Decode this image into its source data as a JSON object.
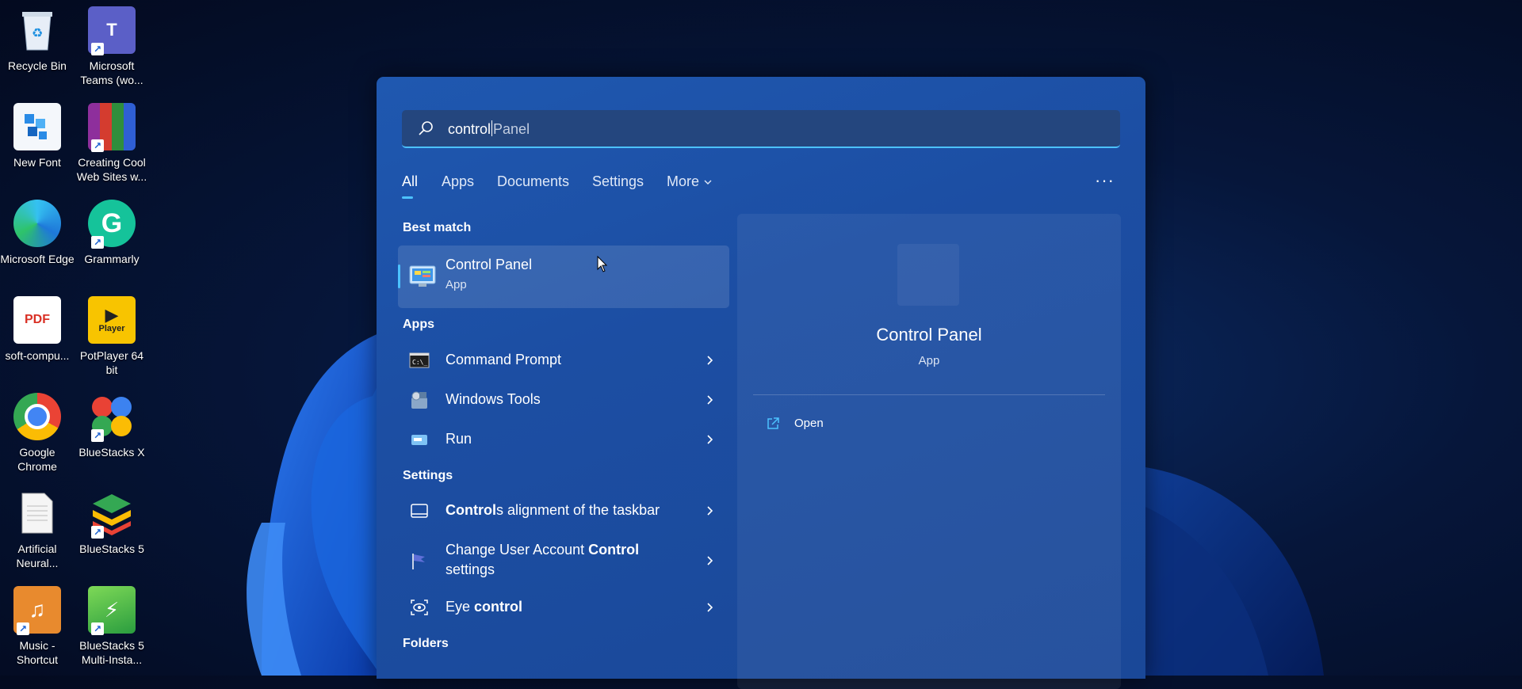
{
  "desktop": {
    "icons": [
      {
        "label": "Recycle Bin",
        "icon": "recycle-bin-icon"
      },
      {
        "label": "Microsoft Teams (wo...",
        "icon": "teams-icon"
      },
      {
        "label": "New Font",
        "icon": "font-file-icon"
      },
      {
        "label": "Creating Cool Web Sites w...",
        "icon": "winrar-icon"
      },
      {
        "label": "Microsoft Edge",
        "icon": "edge-icon"
      },
      {
        "label": "Grammarly",
        "icon": "grammarly-icon"
      },
      {
        "label": "soft-compu...",
        "icon": "pdf-icon",
        "glyph": "PDF"
      },
      {
        "label": "PotPlayer 64 bit",
        "icon": "potplayer-icon",
        "glyph": "Player"
      },
      {
        "label": "Google Chrome",
        "icon": "chrome-icon"
      },
      {
        "label": "BlueStacks X",
        "icon": "bluestacks-x-icon"
      },
      {
        "label": "Artificial Neural...",
        "icon": "text-document-icon"
      },
      {
        "label": "BlueStacks 5",
        "icon": "bluestacks5-icon"
      },
      {
        "label": "Music - Shortcut",
        "icon": "music-folder-icon"
      },
      {
        "label": "BlueStacks 5 Multi-Insta...",
        "icon": "bluestacks-multi-icon"
      }
    ]
  },
  "search": {
    "typed": "control",
    "suggestion": "Panel",
    "tabs": [
      "All",
      "Apps",
      "Documents",
      "Settings",
      "More"
    ],
    "more_icon": "more-options-icon"
  },
  "results": {
    "best_match_header": "Best match",
    "best_match": {
      "name": "Control Panel",
      "type": "App"
    },
    "apps_header": "Apps",
    "apps": [
      {
        "label": "Command Prompt",
        "icon": "command-prompt-icon"
      },
      {
        "label": "Windows Tools",
        "icon": "windows-tools-icon"
      },
      {
        "label": "Run",
        "icon": "run-icon"
      }
    ],
    "settings_header": "Settings",
    "settings": [
      {
        "bold": "Control",
        "rest": "s alignment of the taskbar",
        "icon": "taskbar-icon"
      },
      {
        "pre": "Change User Account ",
        "bold": "Control",
        "rest": " settings",
        "icon": "uac-flag-icon"
      },
      {
        "pre": "Eye ",
        "bold": "control",
        "rest": "",
        "icon": "eye-control-icon"
      }
    ],
    "folders_header": "Folders"
  },
  "preview": {
    "title": "Control Panel",
    "type": "App",
    "open_label": "Open"
  }
}
